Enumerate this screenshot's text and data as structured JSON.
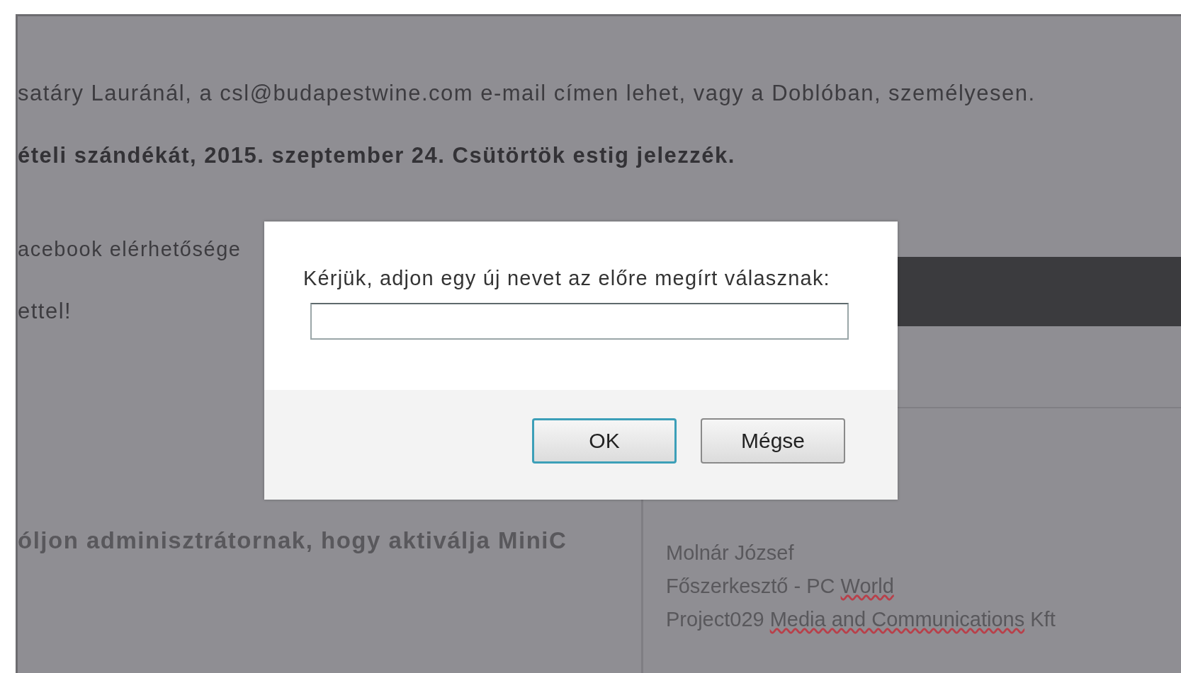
{
  "message": {
    "lines": [
      {
        "text": "satáry Lauránál, a csl@budapestwine.com e-mail címen lehet, vagy a Doblóban, személyesen.",
        "bold": false
      },
      {
        "text": "ételi szándékát, 2015. szeptember 24. Csütörtök estig jelezzék.",
        "bold": true
      },
      {
        "text": "acebook elérhetősége",
        "bold": false
      },
      {
        "text": "ettel!",
        "bold": false
      }
    ]
  },
  "notice": {
    "text": "óljon adminisztrátornak, hogy aktiválja MiniC"
  },
  "signature": {
    "lines": [
      [
        {
          "text": "Molnár József",
          "misspelled": false
        }
      ],
      [
        {
          "text": "Főszerkesztő - PC ",
          "misspelled": false
        },
        {
          "text": "World",
          "misspelled": true
        }
      ],
      [
        {
          "text": "Project029 ",
          "misspelled": false
        },
        {
          "text": "Media and Communications",
          "misspelled": true
        },
        {
          "text": " Kft",
          "misspelled": false
        }
      ]
    ]
  },
  "dialog": {
    "prompt": "Kérjük, adjon egy új nevet az előre megírt válasznak:",
    "buttons": [
      {
        "label": "OK",
        "focused": true
      },
      {
        "label": "Mégse",
        "focused": false
      }
    ]
  }
}
